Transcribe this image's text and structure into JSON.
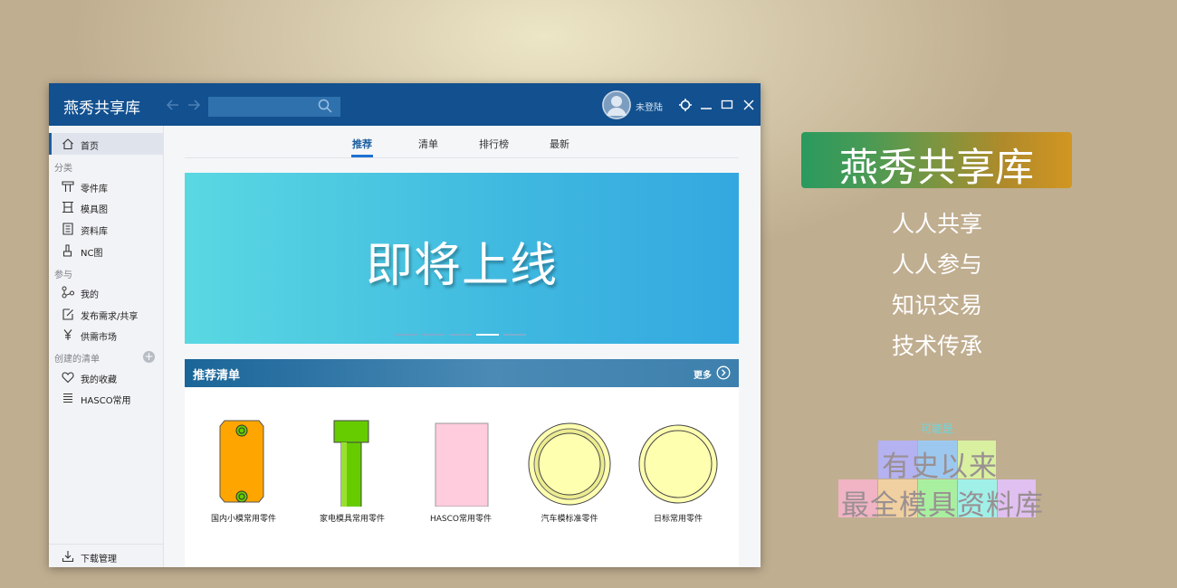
{
  "window": {
    "title": "燕秀共享库",
    "login_label": "未登陆",
    "search_placeholder": ""
  },
  "sidebar": {
    "home": "首页",
    "sections": {
      "category": "分类",
      "participate": "参与",
      "created_lists": "创建的清单"
    },
    "category_items": [
      "零件库",
      "模具图",
      "资料库",
      "NC图"
    ],
    "participate_items": [
      "我的",
      "发布需求/共享",
      "供需市场"
    ],
    "list_items": [
      "我的收藏",
      "HASCO常用"
    ],
    "bottom": "下载管理"
  },
  "main": {
    "tabs": [
      "推荐",
      "清单",
      "排行榜",
      "最新"
    ],
    "active_tab": 0,
    "banner_text": "即将上线",
    "banner_dot_count": 5,
    "banner_active_dot": 3,
    "recommend_title": "推荐清单",
    "more_label": "更多",
    "cards": [
      "国内小模常用零件",
      "家电模具常用零件",
      "HASCO常用零件",
      "汽车模标准零件",
      "日标常用零件"
    ]
  },
  "promo": {
    "brand": "燕秀共享库",
    "slogans": [
      "人人共享",
      "人人参与",
      "知识交易",
      "技术传承"
    ],
    "maybe_label": "可能是",
    "tagline_1": "有史以来",
    "tagline_2": "最全模具资料库"
  },
  "colors": {
    "titlebar": "#12508f",
    "accent": "#1d72d1",
    "banner_from": "#5ad8e2",
    "banner_to": "#33a8e0",
    "part_orange": "#ffa500",
    "part_green": "#66cc00",
    "part_pink": "#ffccdd",
    "part_yellow": "#ffffb0"
  }
}
